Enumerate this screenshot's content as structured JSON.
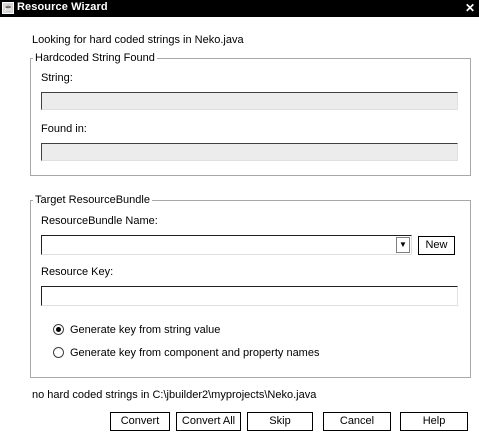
{
  "window": {
    "title": "Resource Wizard",
    "close_glyph": "✕"
  },
  "status_top": "Looking for hard coded strings in Neko.java",
  "hardcoded_group": {
    "legend": "Hardcoded String Found",
    "string_label": "String:",
    "string_value": "",
    "found_in_label": "Found in:",
    "found_in_value": ""
  },
  "target_group": {
    "legend": "Target ResourceBundle",
    "bundle_name_label": "ResourceBundle Name:",
    "bundle_name_value": "",
    "new_button": "New",
    "resource_key_label": "Resource Key:",
    "resource_key_value": "",
    "radio_options": [
      {
        "label": "Generate key from string value",
        "checked": true
      },
      {
        "label": "Generate key from component and property names",
        "checked": false
      }
    ]
  },
  "status_bottom": "no hard coded strings in C:\\jbuilder2\\myprojects\\Neko.java",
  "buttons": {
    "convert": "Convert",
    "convert_all": "Convert All",
    "skip": "Skip",
    "cancel": "Cancel",
    "help": "Help"
  }
}
